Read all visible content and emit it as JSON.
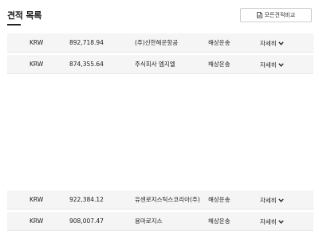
{
  "header": {
    "title": "견적 목록",
    "compare_button_label": "모든견적비교"
  },
  "quotes_top": [
    {
      "currency": "KRW",
      "amount": "892,718.94",
      "company": "(주)신한해운항공",
      "service": "해상운송",
      "detail_label": "자세히"
    },
    {
      "currency": "KRW",
      "amount": "874,355.64",
      "company": "주식회사 엠지엘",
      "service": "해상운송",
      "detail_label": "자세히"
    }
  ],
  "quotes_bottom": [
    {
      "currency": "KRW",
      "amount": "922,384.12",
      "company": "유센로지스틱스코리아(주)",
      "service": "해상운송",
      "detail_label": "자세히"
    },
    {
      "currency": "KRW",
      "amount": "908,007.47",
      "company": "용마로지스",
      "service": "해상운송",
      "detail_label": "자세히"
    }
  ],
  "icons": {
    "compare": "document-icon",
    "expand": "chevron-down-icon"
  }
}
